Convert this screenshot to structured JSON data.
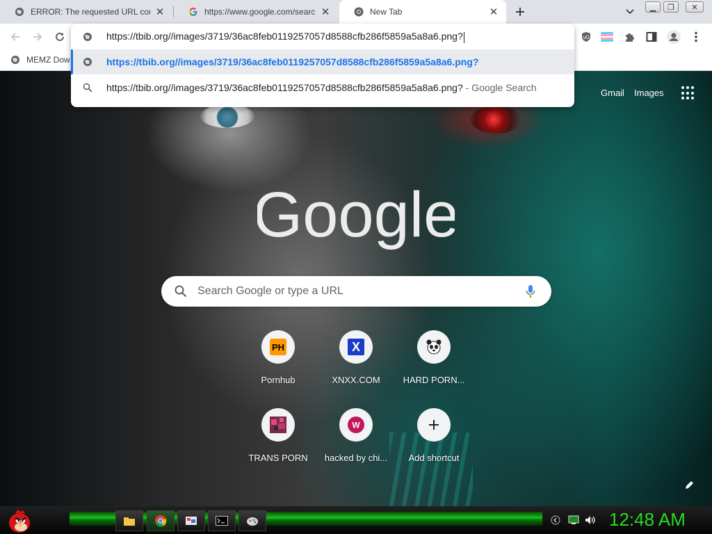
{
  "tabs": [
    {
      "title": "ERROR: The requested URL could",
      "favicon": "globe-icon",
      "active": false
    },
    {
      "title": "https://www.google.com/search?",
      "favicon": "google-g-icon",
      "active": false
    },
    {
      "title": "New Tab",
      "favicon": "chrome-icon",
      "active": true
    }
  ],
  "toolbar": {
    "back": "back-arrow-icon",
    "forward": "forward-arrow-icon",
    "reload": "reload-icon",
    "extensions": [
      "ublock-origin-icon",
      "pride-flag-icon",
      "puzzle-extensions-icon",
      "side-panel-icon",
      "profile-icon",
      "kebab-menu-icon"
    ]
  },
  "bookmarks": [
    {
      "label": "MEMZ Dow",
      "icon": "globe-icon"
    }
  ],
  "omnibox": {
    "input_value": "https://tbib.org//images/3719/36ac8feb0119257057d8588cfb286f5859a5a8a6.png?",
    "suggestions": [
      {
        "text": "https://tbib.org//images/3719/36ac8feb0119257057d8588cfb286f5859a5a8a6.png?",
        "suffix": "",
        "icon": "globe-icon",
        "selected": true
      },
      {
        "text": "https://tbib.org//images/3719/36ac8feb0119257057d8588cfb286f5859a5a8a6.png?",
        "suffix": " - Google Search",
        "icon": "search-icon",
        "selected": false
      }
    ]
  },
  "ntp": {
    "gmail": "Gmail",
    "images": "Images",
    "logo_text": "Google",
    "search_placeholder": "Search Google or type a URL",
    "shortcuts": [
      {
        "label": "Pornhub",
        "icon": "ph-logo-icon",
        "badge": "PH"
      },
      {
        "label": "XNXX.COM",
        "icon": "x-logo-icon",
        "badge": "X"
      },
      {
        "label": "HARD PORN...",
        "icon": "panda-icon",
        "badge": ""
      },
      {
        "label": "TRANS PORN",
        "icon": "pixel-image-icon",
        "badge": ""
      },
      {
        "label": "hacked by chi...",
        "icon": "w-letter-icon",
        "badge": "W"
      },
      {
        "label": "Add shortcut",
        "icon": "plus-icon",
        "badge": "+"
      }
    ]
  },
  "taskbar": {
    "clock": "12:48 AM",
    "pinned": [
      "folder-icon",
      "chrome-icon",
      "paint-icon",
      "terminal-icon",
      "game-icon"
    ],
    "tray": [
      "chevron-left-icon",
      "network-icon",
      "volume-icon"
    ]
  },
  "colors": {
    "accent_blue": "#1a73e8",
    "clock_green": "#22dd22",
    "taskbar_green": "#19c419"
  }
}
